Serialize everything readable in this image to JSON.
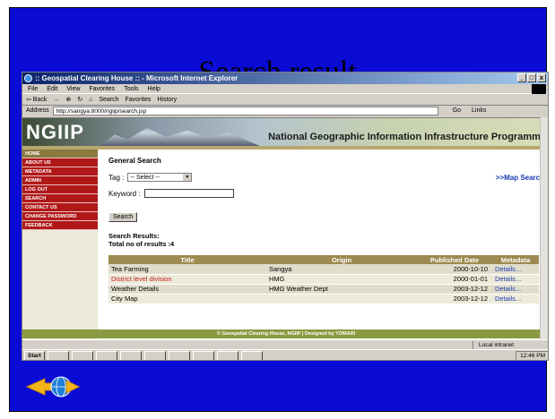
{
  "slide": {
    "title": "Search result",
    "background": "#0b0bd6"
  },
  "browser": {
    "title": ":: Geospatial Clearing House :: - Microsoft Internet Explorer",
    "window_buttons": [
      "_",
      "□",
      "x"
    ],
    "menu": [
      "File",
      "Edit",
      "View",
      "Favorites",
      "Tools",
      "Help"
    ],
    "toolbar": [
      "⇦ Back",
      "→",
      "⊗",
      "↻",
      "⌂",
      "Search",
      "Favorites",
      "History"
    ],
    "address_label": "Address",
    "address_value": "http://sangya:8000/ngiip/search.jsp",
    "go_label": "Go",
    "links_label": "Links"
  },
  "site": {
    "logo": "NGIIP",
    "program_name": "National Geographic Information Infrastructure Programme",
    "nav": [
      "HOME",
      "ABOUT US",
      "METADATA",
      "ADMIN",
      "LOG OUT",
      "SEARCH",
      "CONTACT US",
      "CHANGE PASSWORD",
      "FEEDBACK"
    ],
    "general_search": "General Search",
    "tag_label": "Tag :",
    "tag_value": "-- Select --",
    "keyword_label": "Keyword :",
    "map_search": ">>Map Search",
    "search_button": "Search",
    "results_heading": "Search Results:",
    "results_total": "Total no of results :4",
    "table": {
      "headers": [
        "Title",
        "Origin",
        "Published Date",
        "Metadata"
      ],
      "rows": [
        {
          "title": "Tea Farming",
          "origin": "Sangya",
          "date": "2000-10-10",
          "meta": "Details..."
        },
        {
          "title": "District level division",
          "origin": "HMG",
          "date": "2000-01-01",
          "meta": "Details..."
        },
        {
          "title": "Weather Details",
          "origin": "HMG Weather Dept",
          "date": "2003-12-12",
          "meta": "Details..."
        },
        {
          "title": "City Map",
          "origin": "",
          "date": "2003-12-12",
          "meta": "Details..."
        }
      ]
    },
    "footer": "© Geospatial Clearing House, NGIIP | Designed by YOMARI"
  },
  "status": {
    "zone": "Local intranet"
  },
  "taskbar": {
    "start": "Start",
    "clock": "12:46 PM"
  }
}
